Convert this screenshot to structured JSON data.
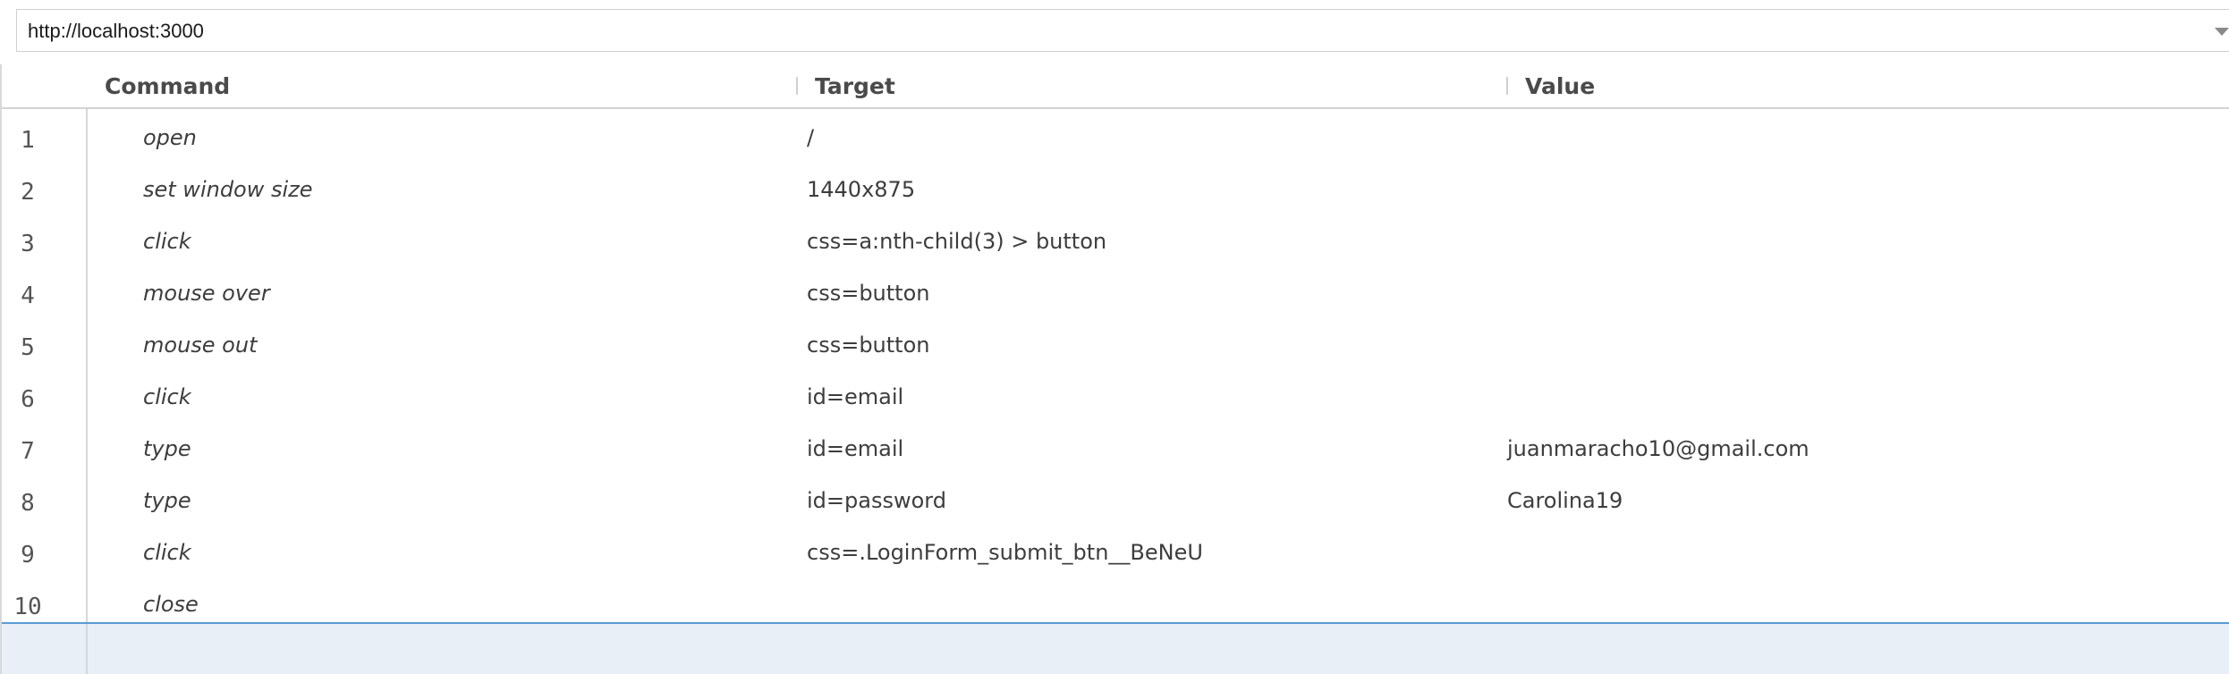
{
  "base_url": {
    "value": "http://localhost:3000"
  },
  "table": {
    "columns": {
      "command": "Command",
      "target": "Target",
      "value": "Value"
    },
    "rows": [
      {
        "num": "1",
        "command": "open",
        "target": "/",
        "value": ""
      },
      {
        "num": "2",
        "command": "set window size",
        "target": "1440x875",
        "value": ""
      },
      {
        "num": "3",
        "command": "click",
        "target": "css=a:nth-child(3) > button",
        "value": ""
      },
      {
        "num": "4",
        "command": "mouse over",
        "target": "css=button",
        "value": ""
      },
      {
        "num": "5",
        "command": "mouse out",
        "target": "css=button",
        "value": ""
      },
      {
        "num": "6",
        "command": "click",
        "target": "id=email",
        "value": ""
      },
      {
        "num": "7",
        "command": "type",
        "target": "id=email",
        "value": "juanmaracho10@gmail.com"
      },
      {
        "num": "8",
        "command": "type",
        "target": "id=password",
        "value": "Carolina19"
      },
      {
        "num": "9",
        "command": "click",
        "target": "css=.LoginForm_submit_btn__BeNeU",
        "value": ""
      },
      {
        "num": "10",
        "command": "close",
        "target": "",
        "value": ""
      }
    ]
  },
  "colors": {
    "selection_line": "#5b9bd5",
    "new_row_bg": "#e9eff6"
  }
}
